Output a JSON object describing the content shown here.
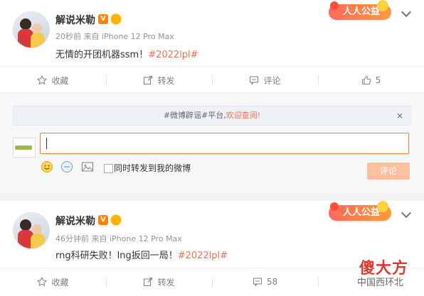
{
  "posts": [
    {
      "author": "解说米勒",
      "verified_badge": "V",
      "time": "20秒前",
      "source": "来自 iPhone 12 Pro Max",
      "text": "无情的开团机器ssm！",
      "hashtag": "#2022lpl#",
      "banner": "人人公益",
      "actions": {
        "favorite": "收藏",
        "repost": "转发",
        "comment": "评论",
        "like_count": "5"
      }
    },
    {
      "author": "解说米勒",
      "verified_badge": "V",
      "time": "46分钟前",
      "source": "来自 iPhone 12 Pro Max",
      "text": "rng科研失败！lng扳回一局！",
      "hashtag": "#2022lpl#",
      "banner": "人人公益",
      "actions": {
        "favorite": "收藏",
        "repost": "转发",
        "comment": "58",
        "like_count": ""
      }
    }
  ],
  "composer": {
    "notice_prefix": "#微博辟谣#平台,",
    "notice_link": "欢迎查阅!",
    "notice_close": "×",
    "input_value": "",
    "repost_checkbox_label": "同时转发到我的微博",
    "submit_label": "评论"
  },
  "watermark": {
    "line1": "傻大方",
    "line2": "中国西环北"
  },
  "colors": {
    "accent": "#eb7350",
    "input_border": "#fa7d3c",
    "submit_bg": "#ffc09f"
  }
}
